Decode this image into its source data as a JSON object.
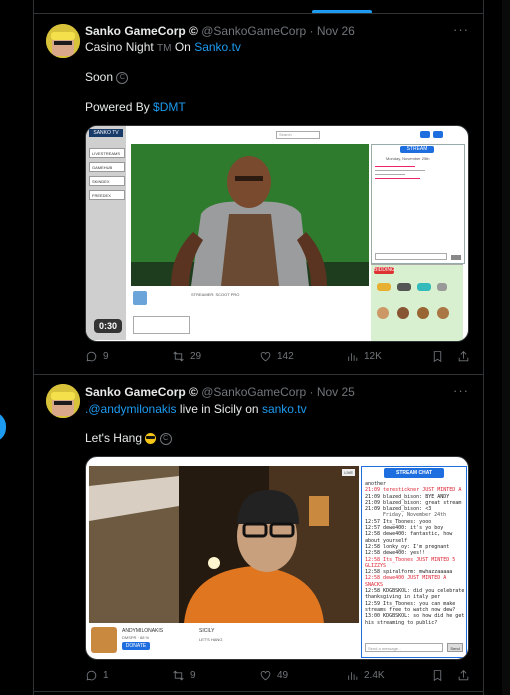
{
  "tweets": [
    {
      "author": "Sanko GameCorp ©",
      "handle": "@SankoGameCorp",
      "date": "Nov 26",
      "line1_prefix": "Casino Night",
      "line1_tm": "TM",
      "line1_on": "On",
      "line1_link": "Sanko.tv",
      "line2": "Soon",
      "line3_prefix": "Powered By",
      "line3_link": "$DMT",
      "video_time": "0:30",
      "actions": {
        "reply": "9",
        "retweet": "29",
        "like": "142",
        "views": "12K"
      },
      "media": {
        "logo": "SANKO TV",
        "sidebar": [
          "LIVESTREAMS",
          "GAMEHUB",
          "SKINDEX",
          "FREEDEX"
        ],
        "search_placeholder": "Search",
        "chat_title": "STREAM CHAT",
        "chat_date": "Monday, November 25th",
        "streamer_info": "STREAMER: SCOOT PRO",
        "buttons": [
          "BIDDING",
          "Send"
        ],
        "items_label": "Bid Items"
      }
    },
    {
      "author": "Sanko GameCorp ©",
      "handle": "@SankoGameCorp",
      "date": "Nov 25",
      "mention": ".@andymilonakis",
      "line1_mid": "live in Sicily on",
      "line1_link": "sanko.tv",
      "line2": "Let's Hang",
      "actions": {
        "reply": "1",
        "retweet": "9",
        "like": "49",
        "views": "2.4K"
      },
      "media": {
        "chat_title": "STREAM CHAT",
        "streamer_name": "ANDYMILONAKIS",
        "streamer_sub": "DMSPR · 88 %",
        "stream_title": "SICILY",
        "stream_sub": "LET'S HANG",
        "donate_btn": "DONATE",
        "viewer_badge": "LIVE",
        "chat_input": "Send a message...",
        "chat_send": "Send",
        "chat_lines": [
          "another",
          "21:09 terestickner JUST MINTED A CIGARETTE",
          "21:09 blazed_bison: BYE ANDY",
          "21:09 blazed_bison: great stream",
          "21:09 blazed_bison: <3",
          "Friday, November 24th",
          "12:57 Its_Tbones: yooo",
          "12:57 dewe400: it's yo boy",
          "12:58 dewe400: fantastic, how",
          "about yourself",
          "12:58 lonky_oy: I'm pregnant",
          "12:58 dewe400: yes!!",
          "12:58 Its_Tbones JUST MINTED 5",
          "GLIZZYS",
          "12:58 spiralform: mwhazzaaaaa",
          "12:58 dewe400 JUST MINTED A",
          "SNACKS",
          "12:58 KDGBSKOL: did you celebrate",
          "thanksgiving in italy per",
          "12:59 Its_Tbones: you can make",
          "streams free to watch now dew?",
          "13:00 KDGBSKOL: so how did he get",
          "his streaming to public?"
        ]
      }
    }
  ],
  "colors": {
    "accent": "#1d9bf0",
    "background": "#000000",
    "text": "#e7e9ea",
    "muted": "#71767b"
  }
}
